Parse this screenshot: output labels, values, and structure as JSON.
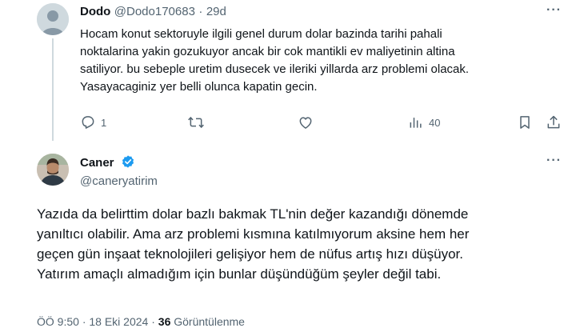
{
  "reply": {
    "display_name": "Dodo",
    "handle": "@Dodo170683",
    "separator": "·",
    "time": "29d",
    "lines": [
      "Hocam konut sektoruyle ilgili genel durum dolar bazinda tarihi pahali",
      "noktalarina yakin gozukuyor ancak bir cok mantikli ev maliyetinin altina",
      "satiliyor. bu sebeple uretim dusecek ve ileriki yillarda arz problemi olacak.",
      "Yasayacaginiz yer belli olunca kapatin gecin."
    ],
    "reply_count": "1",
    "view_count": "40"
  },
  "main": {
    "display_name": "Caner",
    "handle": "@caneryatirim",
    "lines": [
      "Yazıda da belirttim dolar bazlı bakmak TL'nin değer kazandığı dönemde",
      "yanıltıcı olabilir. Ama arz problemi kısmına katılmıyorum aksine hem her",
      "geçen gün inşaat teknolojileri gelişiyor hem de nüfus artış hızı düşüyor.",
      "Yatırım amaçlı almadığım için bunlar düşündüğüm şeyler değil tabi."
    ],
    "time": "ÖÖ 9:50",
    "date": "18 Eki 2024",
    "separator": "·",
    "views": "36",
    "views_label": "Görüntülenme"
  },
  "icons": {
    "more": "more-horizontal-icon",
    "reply": "reply-icon",
    "retweet": "retweet-icon",
    "like": "heart-icon",
    "views": "analytics-icon",
    "bookmark": "bookmark-icon",
    "share": "share-icon",
    "verified": "verified-badge-icon"
  },
  "colors": {
    "text": "#0f1419",
    "muted": "#536471",
    "verified": "#1d9bf0",
    "thread_line": "#cfd9de"
  }
}
